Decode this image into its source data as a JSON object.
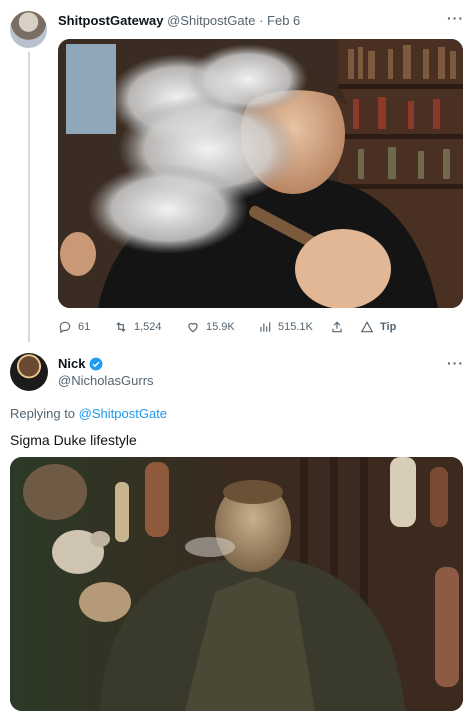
{
  "tweet1": {
    "author_name": "ShitpostGateway",
    "author_handle": "@ShitpostGate",
    "separator": "·",
    "date": "Feb 6",
    "more_label": "···",
    "media": {
      "description_icon": "photo-smoking-man"
    },
    "actions": {
      "replies": "61",
      "retweets": "1,524",
      "likes": "15.9K",
      "views": "515.1K",
      "tip_label": "Tip"
    }
  },
  "tweet2": {
    "author_name": "Nick",
    "author_handle": "@NicholasGurrs",
    "verified": true,
    "more_label": "···",
    "replying_prefix": "Replying to",
    "replying_to": "@ShitpostGate",
    "text": "Sigma Duke lifestyle",
    "media": {
      "description_icon": "photo-game-character"
    }
  },
  "colors": {
    "secondary_text": "#536471",
    "link": "#1d9bf0",
    "thread_line": "#cfd9de"
  }
}
